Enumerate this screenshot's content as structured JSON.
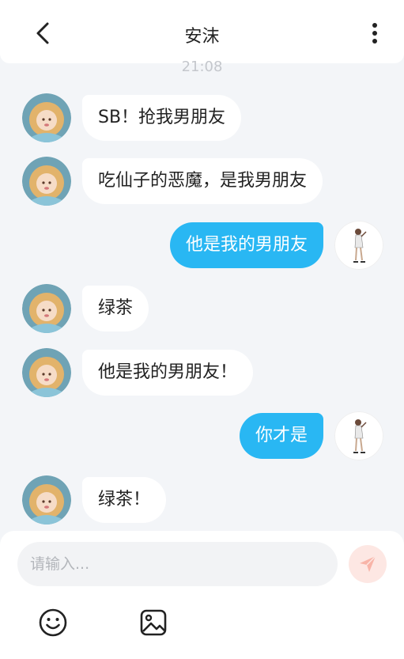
{
  "header": {
    "title": "安沫",
    "back_icon": "chevron-left-icon",
    "more_icon": "more-vertical-icon"
  },
  "timestamp": "21:08",
  "messages": [
    {
      "side": "left",
      "text": "SB！抢我男朋友"
    },
    {
      "side": "left",
      "text": "吃仙子的恶魔，是我男朋友"
    },
    {
      "side": "right",
      "text": "他是我的男朋友"
    },
    {
      "side": "left",
      "text": "绿茶"
    },
    {
      "side": "left",
      "text": "他是我的男朋友！"
    },
    {
      "side": "right",
      "text": "你才是"
    },
    {
      "side": "left",
      "text": "绿茶！"
    }
  ],
  "composer": {
    "placeholder": "请输入...",
    "send_icon": "send-icon",
    "tools": [
      "emoji-icon",
      "image-icon"
    ]
  },
  "colors": {
    "self_bubble": "#29b7f3",
    "other_bubble": "#ffffff",
    "background": "#f3f5f8",
    "send_button": "#fde7e3"
  }
}
